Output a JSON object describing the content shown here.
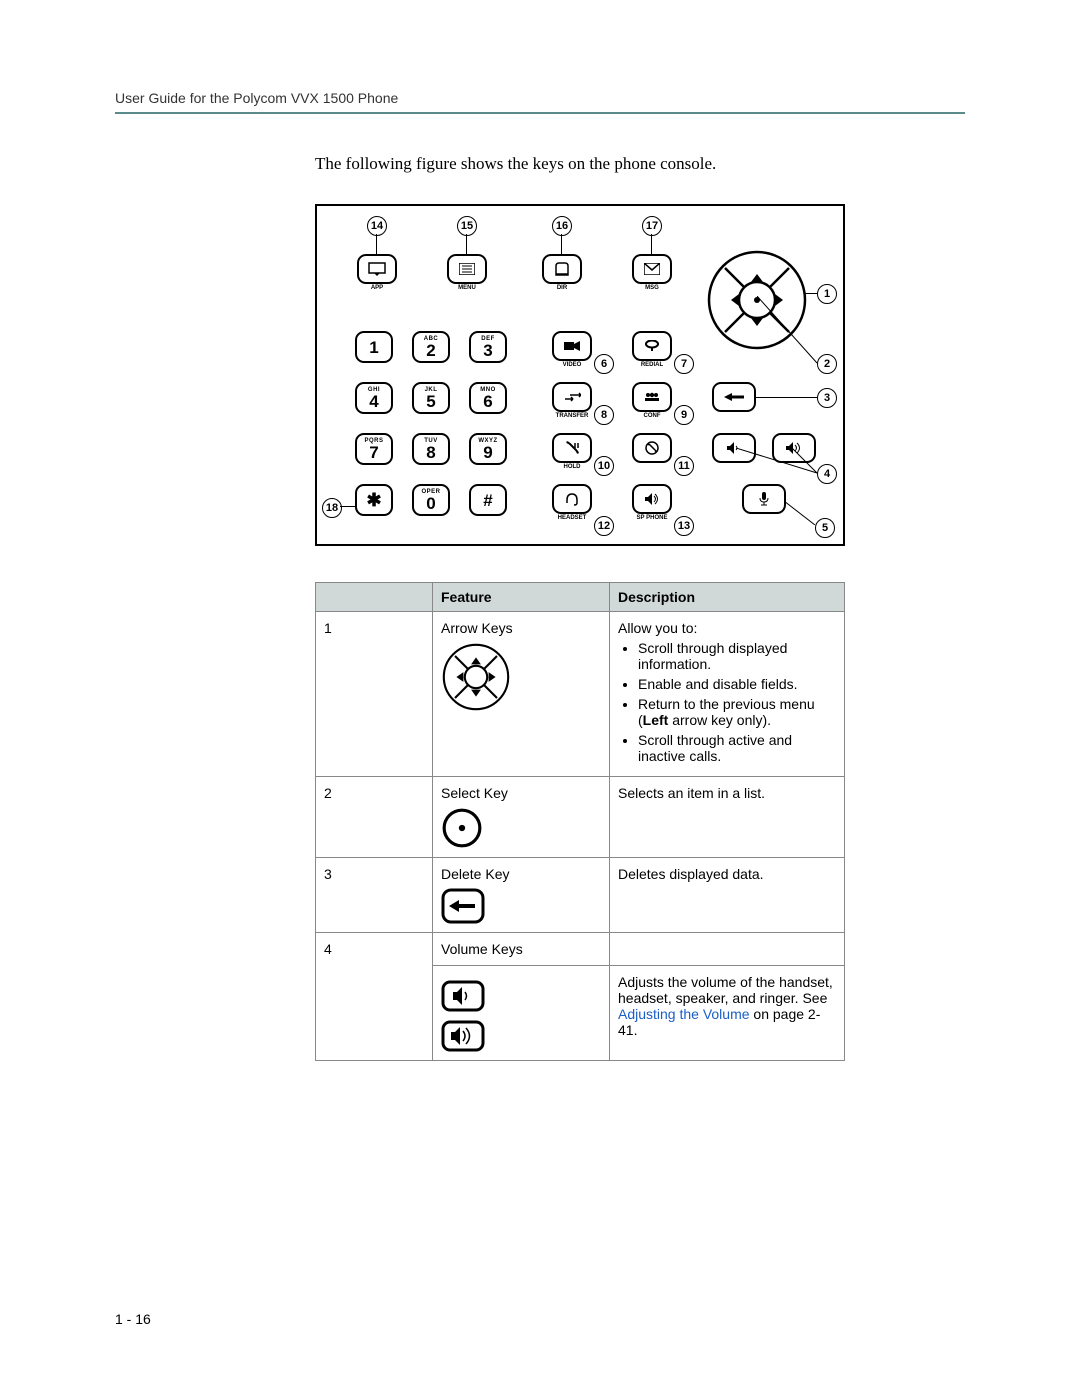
{
  "header": "User Guide for the Polycom VVX 1500 Phone",
  "intro": "The following figure shows the keys on the phone console.",
  "page_number": "1 - 16",
  "callouts": {
    "c1": "1",
    "c2": "2",
    "c3": "3",
    "c4": "4",
    "c5": "5",
    "c6": "6",
    "c7": "7",
    "c8": "8",
    "c9": "9",
    "c10": "10",
    "c11": "11",
    "c12": "12",
    "c13": "13",
    "c14": "14",
    "c15": "15",
    "c16": "16",
    "c17": "17",
    "c18": "18"
  },
  "dialpad": {
    "k1": {
      "digit": "1",
      "letters": ""
    },
    "k2": {
      "digit": "2",
      "letters": "ABC"
    },
    "k3": {
      "digit": "3",
      "letters": "DEF"
    },
    "k4": {
      "digit": "4",
      "letters": "GHI"
    },
    "k5": {
      "digit": "5",
      "letters": "JKL"
    },
    "k6": {
      "digit": "6",
      "letters": "MNO"
    },
    "k7": {
      "digit": "7",
      "letters": "PQRS"
    },
    "k8": {
      "digit": "8",
      "letters": "TUV"
    },
    "k9": {
      "digit": "9",
      "letters": "WXYZ"
    },
    "kstar": {
      "digit": "✱",
      "letters": ""
    },
    "k0": {
      "digit": "0",
      "letters": "OPER"
    },
    "khash": {
      "digit": "#",
      "letters": ""
    }
  },
  "featurekeys": {
    "app": "APP",
    "menu": "MENU",
    "dir": "DIR",
    "msg": "MSG",
    "video": "VIDEO",
    "redial": "REDIAL",
    "transfer": "TRANSFER",
    "conf": "CONF",
    "hold": "HOLD",
    "dnd": "",
    "headset": "HEADSET",
    "spphone": "SP PHONE"
  },
  "table": {
    "headers": {
      "num": "",
      "feature": "Feature",
      "desc": "Description"
    },
    "rows": [
      {
        "num": "1",
        "feature": "Arrow Keys",
        "desc_intro": "Allow you to:",
        "desc_items": [
          "Scroll through displayed information.",
          "Enable and disable fields.",
          "Return to the previous menu (",
          "Scroll through active and inactive calls."
        ],
        "bold_insert": "Left",
        "after_bold": " arrow key only)."
      },
      {
        "num": "2",
        "feature": "Select Key",
        "desc": "Selects an item in a list."
      },
      {
        "num": "3",
        "feature": "Delete Key",
        "desc": "Deletes displayed data."
      },
      {
        "num": "4",
        "feature": "Volume Keys",
        "desc_parts": {
          "p1": "Adjusts the volume of the handset, headset, speaker, and ringer. See ",
          "link": "Adjusting the Volume",
          "p2": " on page 2-41."
        }
      }
    ]
  }
}
